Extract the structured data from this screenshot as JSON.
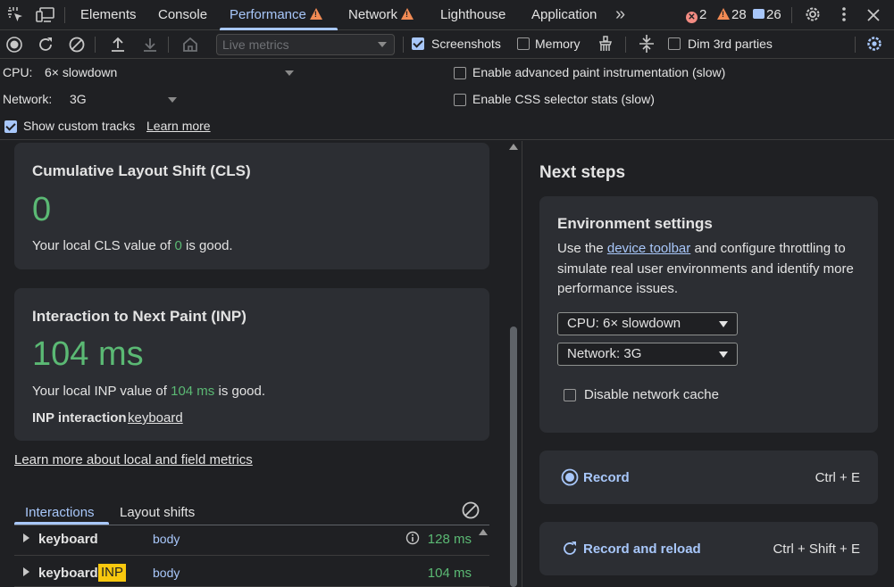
{
  "tabs": {
    "elements": "Elements",
    "console": "Console",
    "performance": "Performance",
    "network": "Network",
    "lighthouse": "Lighthouse",
    "application": "Application",
    "more": "»"
  },
  "badges": {
    "errors": "2",
    "warnings": "28",
    "messages": "26"
  },
  "toolbar": {
    "metrics_select": "Live metrics",
    "screenshots_label": "Screenshots",
    "memory_label": "Memory",
    "dim_label": "Dim 3rd parties",
    "screenshots_checked": true,
    "memory_checked": false,
    "dim_checked": false
  },
  "settings": {
    "cpu_label": "CPU:",
    "cpu_value": "6× slowdown",
    "network_label": "Network:",
    "network_value": "3G",
    "paint_label": "Enable advanced paint instrumentation (slow)",
    "css_label": "Enable CSS selector stats (slow)",
    "custom_tracks_label": "Show custom tracks",
    "learn_more": "Learn more"
  },
  "cls": {
    "title": "Cumulative Layout Shift (CLS)",
    "value": "0",
    "desc_prefix": "Your local CLS value of ",
    "desc_value": "0",
    "desc_suffix": " is good."
  },
  "inp": {
    "title": "Interaction to Next Paint (INP)",
    "value": "104 ms",
    "desc_prefix": "Your local INP value of ",
    "desc_value": "104 ms",
    "desc_suffix": " is good.",
    "interaction_label": "INP interaction",
    "interaction_link": "keyboard"
  },
  "learn_more_metrics": "Learn more about local and field metrics",
  "lower_tabs": {
    "interactions": "Interactions",
    "layout_shifts": "Layout shifts"
  },
  "interactions": [
    {
      "type": "keyboard",
      "badge": "",
      "target": "body",
      "duration": "128 ms"
    },
    {
      "type": "keyboard",
      "badge": "INP",
      "target": "body",
      "duration": "104 ms"
    }
  ],
  "next_steps": {
    "title": "Next steps",
    "env_title": "Environment settings",
    "env_text_1": "Use the ",
    "env_link": "device toolbar",
    "env_text_2": " and configure throttling to",
    "env_text_3": "simulate real user environments and identify more",
    "env_text_4": "performance issues.",
    "cpu_dropdown": "CPU: 6× slowdown",
    "network_dropdown": "Network: 3G",
    "disable_cache": "Disable network cache",
    "record_label": "Record",
    "record_shortcut": "Ctrl + E",
    "reload_label": "Record and reload",
    "reload_shortcut": "Ctrl + Shift + E"
  },
  "colors": {
    "accent": "#a8c7fa",
    "good": "#5bb974",
    "warning": "#f28b54",
    "error": "#f28b82",
    "inp_badge": "#f9c80e"
  }
}
